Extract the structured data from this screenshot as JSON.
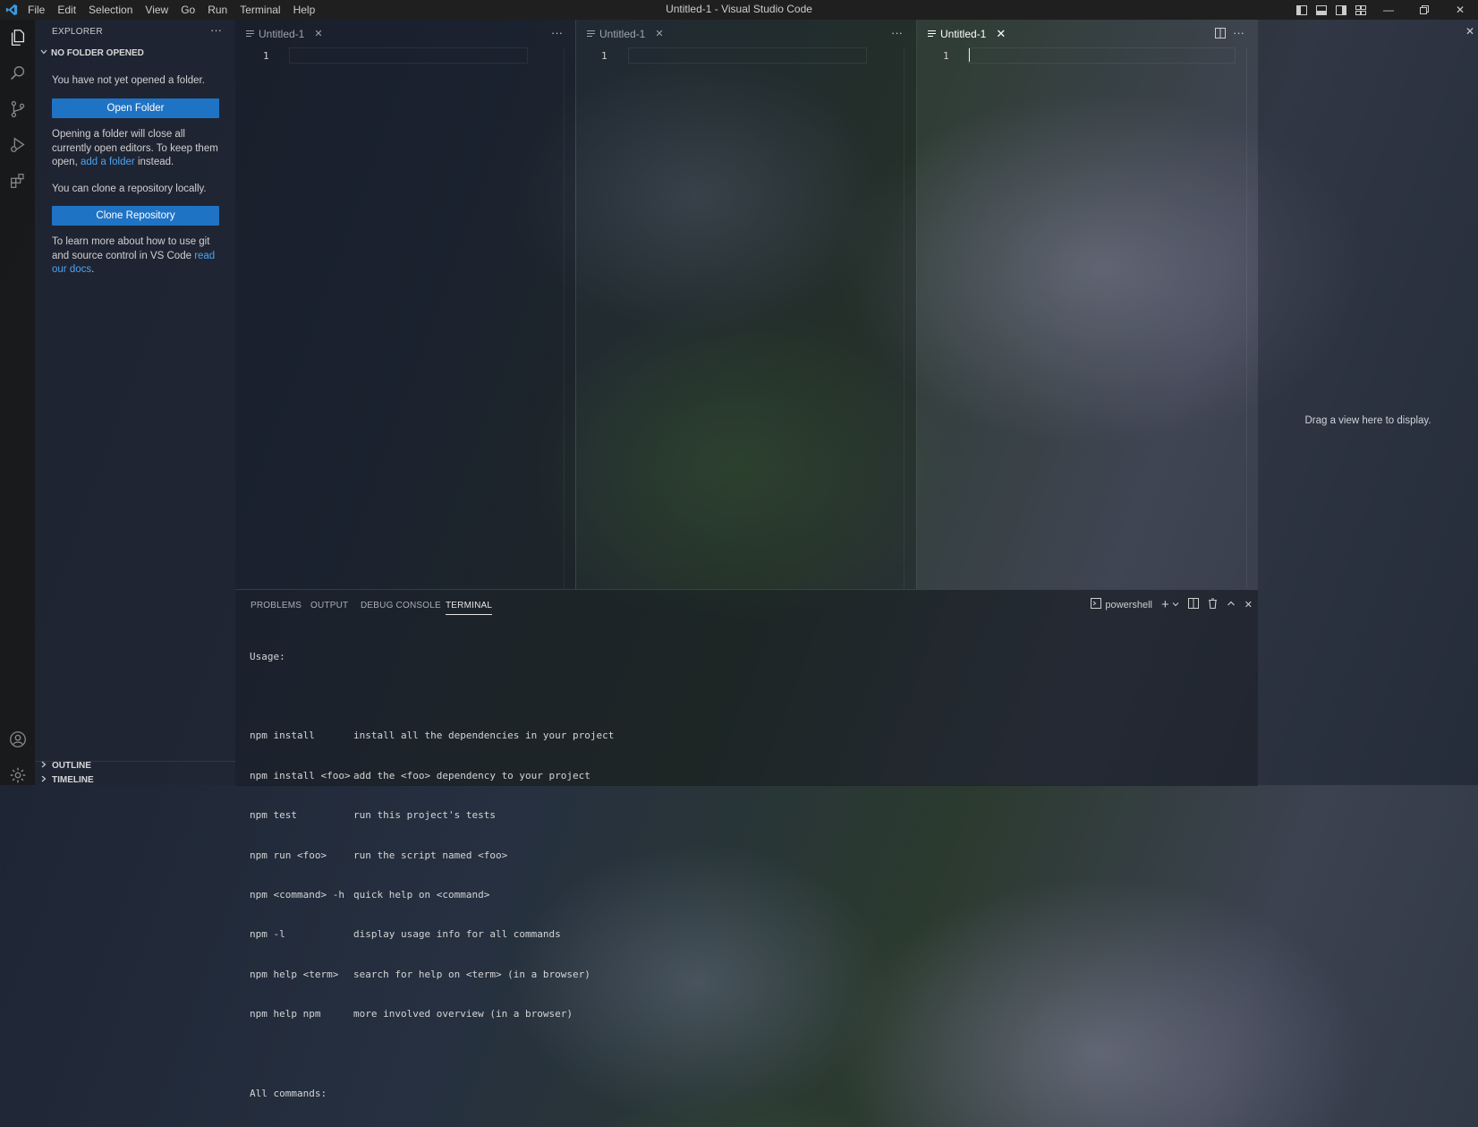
{
  "app": {
    "window_title": "Untitled-1 - Visual Studio Code",
    "menu": [
      "File",
      "Edit",
      "Selection",
      "View",
      "Go",
      "Run",
      "Terminal",
      "Help"
    ],
    "logo_icon": "vscode-logo-icon",
    "brand_color": "#3b9be0"
  },
  "activity_bar": {
    "items": [
      "explorer-icon",
      "search-icon",
      "source-control-icon",
      "run-debug-icon",
      "extensions-icon"
    ],
    "bottom": [
      "account-icon",
      "gear-icon"
    ]
  },
  "sidebar": {
    "title": "EXPLORER",
    "section_header": "NO FOLDER OPENED",
    "no_folder_text": "You have not yet opened a folder.",
    "open_folder_button": "Open Folder",
    "opening_text_before": "Opening a folder will close all currently open editors. To keep them open,",
    "opening_link": "add a folder",
    "opening_text_after": "instead.",
    "clone_text": "You can clone a repository locally.",
    "clone_button": "Clone Repository",
    "learn_text_before": "To learn more about how to use git and source control in VS Code",
    "learn_link": "read our docs",
    "learn_text_after": ".",
    "outline_label": "OUTLINE",
    "timeline_label": "TIMELINE",
    "button_color": "#1f73c4",
    "link_color": "#4aa3f0"
  },
  "editors": [
    {
      "tab_label": "Untitled-1",
      "active": false,
      "line_number": "1"
    },
    {
      "tab_label": "Untitled-1",
      "active": false,
      "line_number": "1"
    },
    {
      "tab_label": "Untitled-1",
      "active": true,
      "line_number": "1"
    }
  ],
  "panel": {
    "tabs": [
      "PROBLEMS",
      "OUTPUT",
      "DEBUG CONSOLE",
      "TERMINAL"
    ],
    "active_tab": "TERMINAL",
    "shell_label": "powershell",
    "terminal": {
      "usage": "Usage:",
      "commands": [
        {
          "cmd": "npm install",
          "desc": "install all the dependencies in your project"
        },
        {
          "cmd": "npm install <foo>",
          "desc": "add the <foo> dependency to your project"
        },
        {
          "cmd": "npm test",
          "desc": "run this project's tests"
        },
        {
          "cmd": "npm run <foo>",
          "desc": "run the script named <foo>"
        },
        {
          "cmd": "npm <command> -h",
          "desc": "quick help on <command>"
        },
        {
          "cmd": "npm -l",
          "desc": "display usage info for all commands"
        },
        {
          "cmd": "npm help <term>",
          "desc": "search for help on <term> (in a browser)"
        },
        {
          "cmd": "npm help npm",
          "desc": "more involved overview (in a browser)"
        }
      ],
      "all_commands": "All commands:"
    }
  },
  "secondary_sidebar": {
    "hint": "Drag a view here to display."
  }
}
